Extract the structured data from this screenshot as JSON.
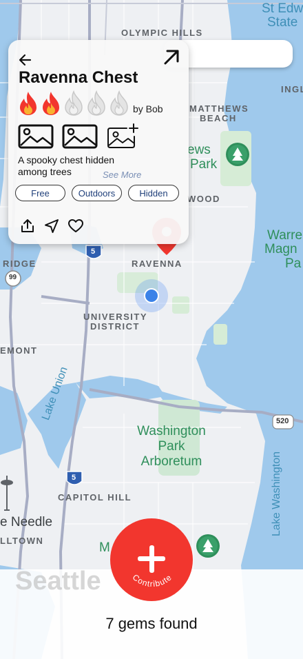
{
  "map": {
    "labels": {
      "olympic_hills": "OLYMPIC HILLS",
      "st_edward": "St Edw",
      "state": "State",
      "matthews_1": "MATTHEWS",
      "matthews_2": "BEACH",
      "inglewood": "INGL",
      "news_park_1": "ews",
      "news_park_2": "Park",
      "wood": "WOOD",
      "warren_1": "Warre",
      "warren_2": "Magn",
      "warren_3": "Pa",
      "ridge": "RIDGE",
      "ravenna": "RAVENNA",
      "university_1": "UNIVERSITY",
      "university_2": "DISTRICT",
      "fremont": "EMONT",
      "lake_union": "Lake Union",
      "washington_park_1": "Washington",
      "washington_park_2": "Park",
      "washington_park_3": "Arboretum",
      "lake_washington": "Lake Washington",
      "capitol_hill": "CAPITOL HILL",
      "space_needle": "e Needle",
      "belltown": "LLTOWN",
      "m": "M",
      "seattle": "Seattle",
      "hwy_99": "99",
      "hwy_5a": "5",
      "hwy_5b": "5",
      "hwy_520": "520"
    }
  },
  "card": {
    "title": "Ravenna Chest",
    "rating_filled": 2,
    "rating_total": 5,
    "byline": "by Bob",
    "description": "A spooky chest hidden among trees",
    "see_more": "See More",
    "tags": [
      "Free",
      "Outdoors",
      "Hidden"
    ]
  },
  "footer": {
    "found_text": "7 gems found",
    "contribute_label": "Contribute"
  },
  "colors": {
    "accent": "#f2362e",
    "location": "#3b82e8",
    "tag_text": "#1f3f7a"
  }
}
